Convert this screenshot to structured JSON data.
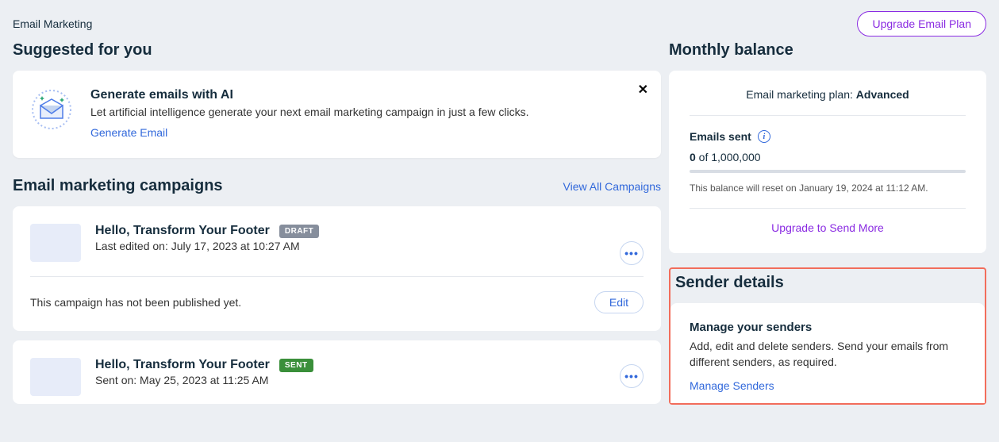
{
  "header": {
    "title": "Email Marketing",
    "upgrade_button": "Upgrade Email Plan"
  },
  "suggested": {
    "heading": "Suggested for you",
    "card": {
      "title": "Generate emails with AI",
      "description": "Let artificial intelligence generate your next email marketing campaign in just a few clicks.",
      "cta": "Generate Email"
    }
  },
  "campaigns": {
    "heading": "Email marketing campaigns",
    "view_all": "View All Campaigns",
    "items": [
      {
        "title": "Hello, Transform Your Footer",
        "badge": "DRAFT",
        "meta": "Last edited on: July 17, 2023 at 10:27 AM",
        "status_text": "This campaign has not been published yet.",
        "action": "Edit"
      },
      {
        "title": "Hello, Transform Your Footer",
        "badge": "SENT",
        "meta": "Sent on: May 25, 2023 at 11:25 AM"
      }
    ]
  },
  "balance": {
    "heading": "Monthly balance",
    "plan_label": "Email marketing plan: ",
    "plan_name": "Advanced",
    "emails_sent_label": "Emails sent",
    "sent_count_bold": "0",
    "sent_count_rest": " of 1,000,000",
    "reset_text": "This balance will reset on January 19, 2024 at 11:12 AM.",
    "upgrade_link": "Upgrade to Send More"
  },
  "sender": {
    "heading": "Sender details",
    "title": "Manage your senders",
    "description": "Add, edit and delete senders. Send your emails from different senders, as required.",
    "cta": "Manage Senders"
  }
}
